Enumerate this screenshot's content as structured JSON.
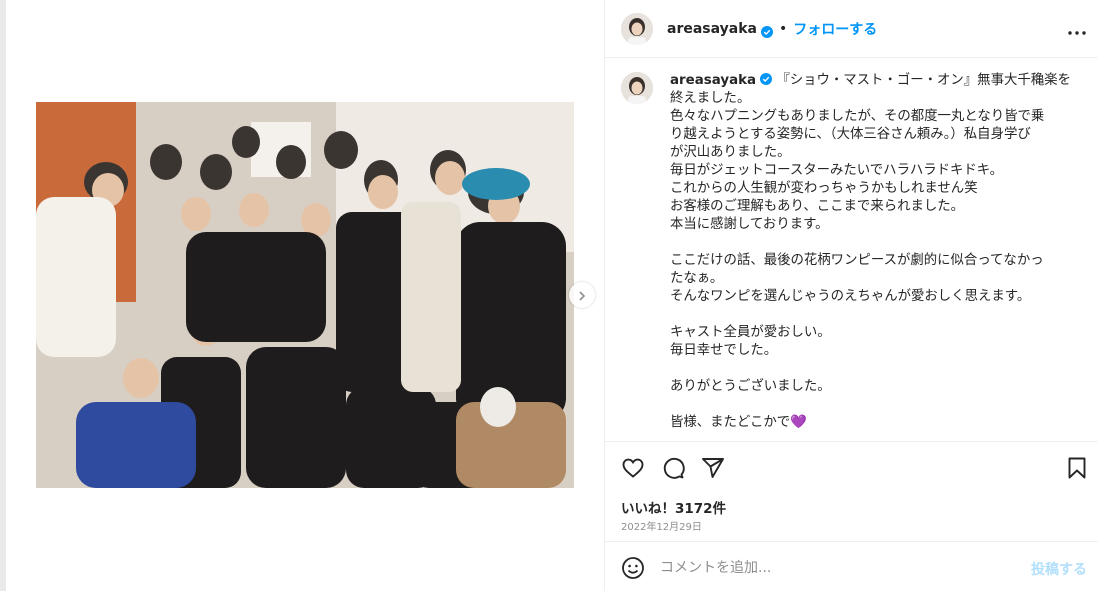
{
  "post": {
    "username": "areasayaka",
    "separator": "•",
    "follow_label": "フォローする",
    "caption_lines": [
      "『ショウ・マスト・ゴー・オン』無事大千穐楽を",
      "終えました。",
      "色々なハプニングもありましたが、その都度一丸となり皆で乗",
      "り越えようとする姿勢に、（大体三谷さん頼み。）私自身学び",
      "が沢山ありました。",
      "毎日がジェットコースターみたいでハラハラドキドキ。",
      "これからの人生観が変わっちゃうかもしれません笑",
      "お客様のご理解もあり、ここまで来られました。",
      "本当に感謝しております。",
      "",
      "ここだけの話、最後の花柄ワンピースが劇的に似合ってなかっ",
      "たなぁ。",
      "そんなワンピを選んじゃうのえちゃんが愛おしく思えます。",
      "",
      "キャスト全員が愛おしい。",
      "毎日幸せでした。",
      "",
      "ありがとうございました。",
      "",
      "皆様、またどこかで💜"
    ],
    "likes_text": "いいね！3172件",
    "date": "2022年12月29日"
  },
  "comment": {
    "placeholder": "コメントを追加...",
    "post_label": "投稿する"
  },
  "icons": {
    "verified": "verified-badge-icon",
    "more": "more-options-icon",
    "like": "heart-icon",
    "comment": "comment-icon",
    "share": "share-icon",
    "save": "bookmark-icon",
    "emoji": "emoji-icon",
    "next": "chevron-right-icon"
  },
  "colors": {
    "accent": "#0095f6",
    "verified": "#0095f6",
    "post_disabled": "#b2dffc",
    "border": "#efefef"
  }
}
